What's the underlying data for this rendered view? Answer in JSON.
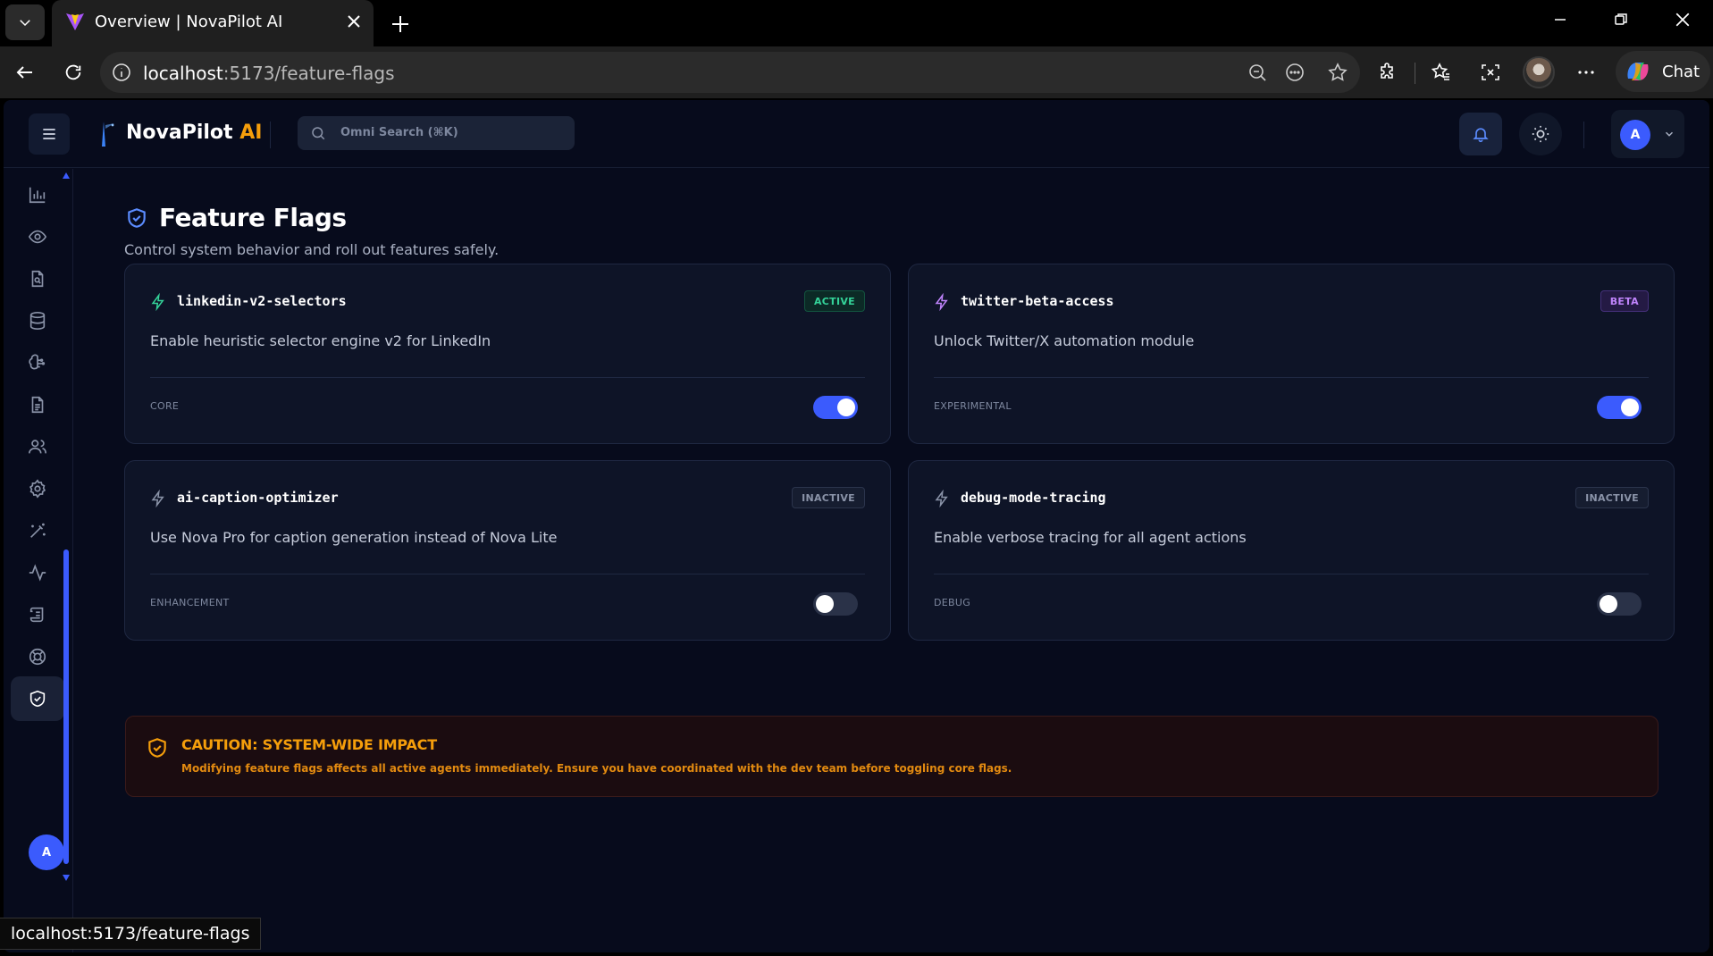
{
  "browser": {
    "tab_title": "Overview | NovaPilot AI",
    "url_host": "localhost",
    "url_path": ":5173/feature-flags",
    "chat_label": "Chat",
    "status_url": "localhost:5173/feature-flags"
  },
  "header": {
    "brand_name": "NovaPilot ",
    "brand_accent": "AI",
    "search_placeholder": "Omni Search (⌘K)",
    "user_initial": "A"
  },
  "sidebar": {
    "items": [
      {
        "icon": "bar-chart-icon"
      },
      {
        "icon": "eye-icon"
      },
      {
        "icon": "file-search-icon"
      },
      {
        "icon": "database-icon"
      },
      {
        "icon": "brain-icon"
      },
      {
        "icon": "document-icon"
      },
      {
        "icon": "users-icon"
      },
      {
        "icon": "gear-icon"
      },
      {
        "icon": "magic-wand-icon"
      },
      {
        "icon": "activity-icon"
      },
      {
        "icon": "scroll-icon"
      },
      {
        "icon": "lifebuoy-icon"
      },
      {
        "icon": "shield-check-icon",
        "active": true
      }
    ],
    "user_initial": "A"
  },
  "page": {
    "title": "Feature Flags",
    "subtitle": "Control system behavior and roll out features safely."
  },
  "flags": [
    {
      "key": "linkedin-v2-selectors",
      "status": "ACTIVE",
      "description": "Enable heuristic selector engine v2 for LinkedIn",
      "category": "CORE",
      "enabled": true
    },
    {
      "key": "twitter-beta-access",
      "status": "BETA",
      "description": "Unlock Twitter/X automation module",
      "category": "EXPERIMENTAL",
      "enabled": true
    },
    {
      "key": "ai-caption-optimizer",
      "status": "INACTIVE",
      "description": "Use Nova Pro for caption generation instead of Nova Lite",
      "category": "ENHANCEMENT",
      "enabled": false
    },
    {
      "key": "debug-mode-tracing",
      "status": "INACTIVE",
      "description": "Enable verbose tracing for all agent actions",
      "category": "DEBUG",
      "enabled": false
    }
  ],
  "caution": {
    "title": "CAUTION: SYSTEM-WIDE IMPACT",
    "body": "Modifying feature flags affects all active agents immediately. Ensure you have coordinated with the dev team before toggling core flags."
  },
  "colors": {
    "accent": "#3b5bfd",
    "brand_accent": "#f59e0b",
    "active": "#34d399",
    "beta": "#c084fc",
    "inactive": "#8a93a8"
  }
}
